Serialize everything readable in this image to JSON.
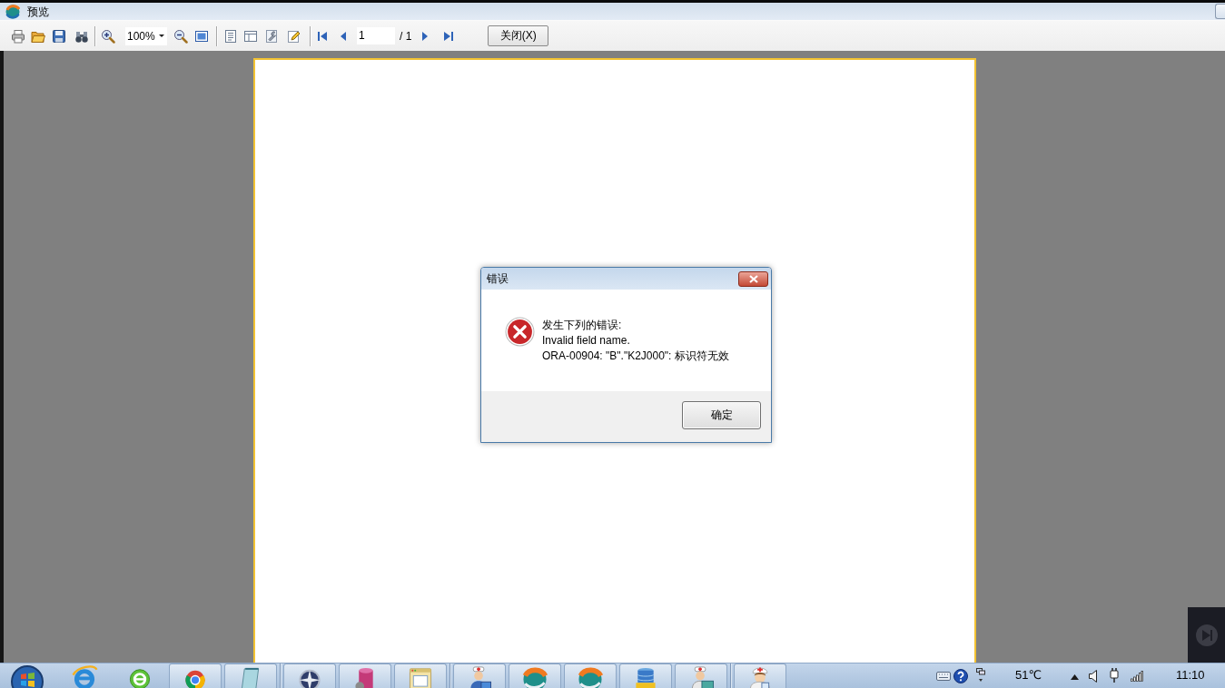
{
  "window": {
    "title": "预览"
  },
  "toolbar": {
    "zoom": {
      "value": "100%"
    },
    "page_field": {
      "value": "1"
    },
    "page_total": "/ 1",
    "close_button": "关闭(X)"
  },
  "dialog": {
    "title": "错误",
    "message": [
      "发生下列的错误:",
      "Invalid field name.",
      "ORA-00904: \"B\".\"K2J000\": 标识符无效"
    ],
    "ok_button": "确定"
  },
  "taskbar": {
    "groups": [
      {
        "apps": [
          {
            "running": false
          },
          {
            "running": false
          },
          {
            "running": true
          },
          {
            "running": true
          }
        ]
      },
      {
        "apps": [
          {
            "running": true
          },
          {
            "running": true
          },
          {
            "running": true
          }
        ]
      },
      {
        "apps": [
          {
            "running": true
          },
          {
            "running": true
          },
          {
            "running": true
          },
          {
            "running": true
          },
          {
            "running": true
          }
        ]
      },
      {
        "apps": [
          {
            "running": true
          }
        ]
      }
    ],
    "tray": {
      "temperature": "51℃",
      "clock": "11:10"
    }
  }
}
